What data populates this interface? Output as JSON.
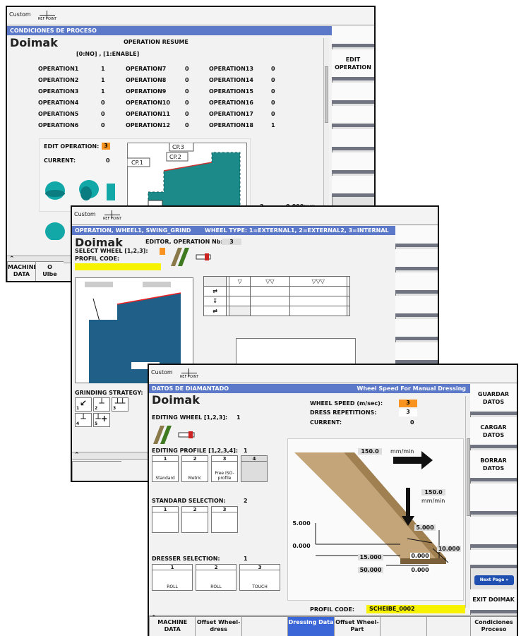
{
  "common": {
    "custom_label": "Custom",
    "ref_point_label": "REF POINT",
    "logo": "Doimak"
  },
  "w1": {
    "header": "CONDICIONES DE PROCESO",
    "resume_title": "OPERATION RESUME",
    "legend": "[0:NO] , [1:ENABLE]",
    "operations": [
      {
        "name": "OPERATION1",
        "value": "1"
      },
      {
        "name": "OPERATION7",
        "value": "0"
      },
      {
        "name": "OPERATION13",
        "value": "0"
      },
      {
        "name": "OPERATION2",
        "value": "1"
      },
      {
        "name": "OPERATION8",
        "value": "0"
      },
      {
        "name": "OPERATION14",
        "value": "0"
      },
      {
        "name": "OPERATION3",
        "value": "1"
      },
      {
        "name": "OPERATION9",
        "value": "0"
      },
      {
        "name": "OPERATION15",
        "value": "0"
      },
      {
        "name": "OPERATION4",
        "value": "0"
      },
      {
        "name": "OPERATION10",
        "value": "0"
      },
      {
        "name": "OPERATION16",
        "value": "0"
      },
      {
        "name": "OPERATION5",
        "value": "0"
      },
      {
        "name": "OPERATION11",
        "value": "0"
      },
      {
        "name": "OPERATION17",
        "value": "0"
      },
      {
        "name": "OPERATION6",
        "value": "0"
      },
      {
        "name": "OPERATION12",
        "value": "0"
      },
      {
        "name": "OPERATION18",
        "value": "1"
      }
    ],
    "edit_op_label": "EDIT OPERATION:",
    "edit_op_value": "3",
    "current_label": "CURRENT:",
    "current_value": "0",
    "cp3": "CP.3",
    "cp2": "CP.2",
    "cp1": "CP.1",
    "num_2": "2",
    "num_val": "0.000mm",
    "softkey_edit": "EDIT OPERATION",
    "hk1": "MACHINE DATA",
    "hk2_top": "O",
    "hk2_bot": "Ulbe"
  },
  "w2": {
    "header": "OPERATION, WHEEL1, SWING_GRIND",
    "header_right": "WHEEL TYPE: 1=EXTERNAL1, 2=EXTERNAL2, 3=INTERNAL",
    "editor_label": "EDITOR, OPERATION Nb:",
    "editor_value": "3",
    "select_wheel": "SELECT WHEEL [1,2,3]:",
    "profil_code": "PROFIL CODE:",
    "grinding_strategy": "GRINDING STRATEGY:",
    "strategy_nums": [
      "1",
      "2",
      "3",
      "4",
      "5"
    ]
  },
  "w3": {
    "header": "DATOS DE DIAMANTADO",
    "header_right": "Wheel Speed For Manual Dressing",
    "wheel_speed_label": "WHEEL SPEED (m/sec):",
    "wheel_speed_value": "3",
    "dress_rep_label": "DRESS REPETITIONS:",
    "dress_rep_value": "3",
    "current_label": "CURRENT:",
    "current_value": "0",
    "editing_wheel_label": "EDITING WHEEL [1,2,3]:",
    "editing_wheel_value": "1",
    "editing_profile_label": "EDITING PROFILE [1,2,3,4]:",
    "editing_profile_value": "1",
    "profiles": [
      {
        "n": "1",
        "cap": "Standard"
      },
      {
        "n": "2",
        "cap": "Metric"
      },
      {
        "n": "3",
        "cap": "Free ISO-profile"
      },
      {
        "n": "4",
        "cap": ""
      }
    ],
    "standard_sel_label": "STANDARD SELECTION:",
    "standard_sel_value": "2",
    "standards": [
      "1",
      "2",
      "3"
    ],
    "dresser_sel_label": "DRESSER SELECTION:",
    "dresser_sel_value": "1",
    "dressers": [
      {
        "n": "1",
        "cap": "ROLL"
      },
      {
        "n": "2",
        "cap": "ROLL"
      },
      {
        "n": "3",
        "cap": "TOUCH"
      }
    ],
    "speed_top": "150.0",
    "speed_top_unit": "mm/min",
    "speed_right": "150.0",
    "speed_right_unit": "mm/min",
    "dim_5000a": "5.000",
    "dim_5000b": "5.000",
    "dim_10000": "10.000",
    "dim_0000a": "0.000",
    "dim_0000b": "0.000",
    "dim_0000c": "0.000",
    "dim_15000": "15.000",
    "dim_50000": "50.000",
    "profil_code_label": "PROFIL CODE:",
    "profil_code_value": "SCHEIBE_0002",
    "softkeys": [
      "GUARDAR DATOS",
      "CARGAR DATOS",
      "BORRAR DATOS"
    ],
    "next_page": "Next Page",
    "exit_label": "EXIT DOIMAK",
    "hk": [
      "MACHINE DATA",
      "Offset Wheel-dress",
      "",
      "Dressing Data",
      "Offset Wheel-Part",
      "",
      "",
      "Condiciones Proceso"
    ],
    "colors": {
      "header": "#5b79c8",
      "active_key": "#3b66d8",
      "selected": "#f7931e",
      "highlight": "#f7f300"
    }
  }
}
